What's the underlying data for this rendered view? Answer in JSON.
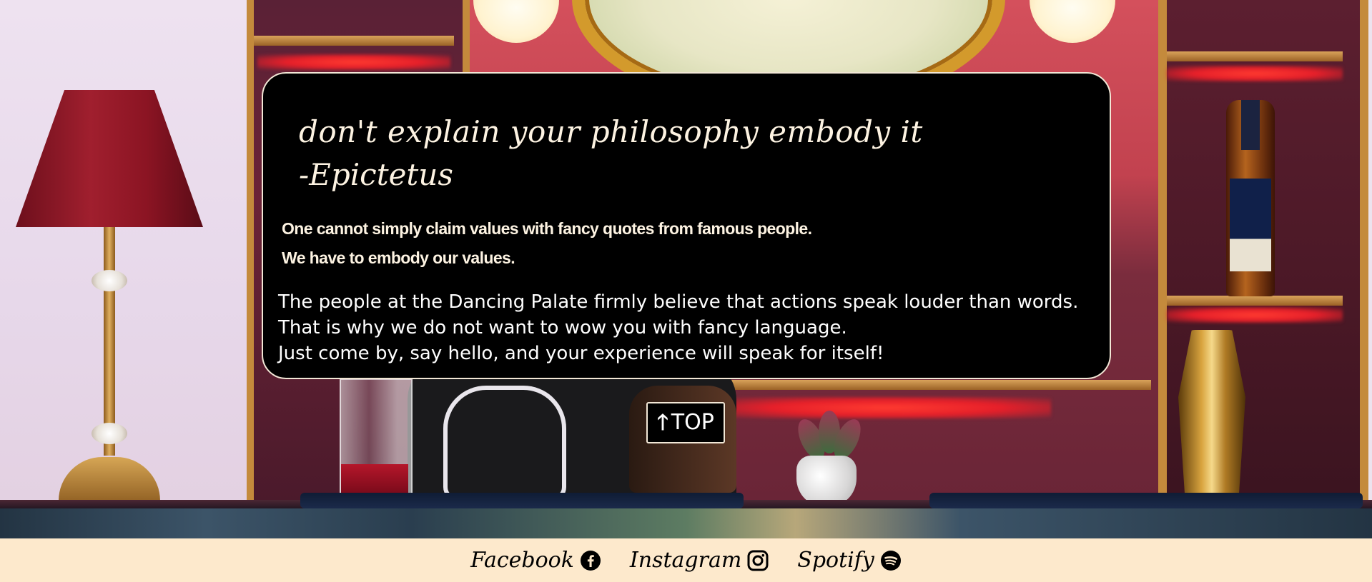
{
  "quote": {
    "text": "don't explain your philosophy embody it",
    "author": "-Epictetus"
  },
  "claims": [
    "One cannot simply claim values with fancy quotes from famous people.",
    "We have to embody our values."
  ],
  "body_lines": [
    "The people at the Dancing Palate firmly believe that actions speak louder than words.",
    "That is why we do not want to wow you with fancy language.",
    "Just come by, say hello, and your experience will speak for itself!"
  ],
  "top_button": {
    "arrow": "🡑",
    "label": "TOP"
  },
  "footer": {
    "links": [
      {
        "label": "Facebook",
        "icon": "facebook-icon"
      },
      {
        "label": "Instagram",
        "icon": "instagram-icon"
      },
      {
        "label": "Spotify",
        "icon": "spotify-icon"
      }
    ]
  },
  "colors": {
    "card_background": "#000000",
    "card_border": "#f2e7d6",
    "text_light": "#fdf3e2",
    "footer_background": "#fde9cc"
  }
}
